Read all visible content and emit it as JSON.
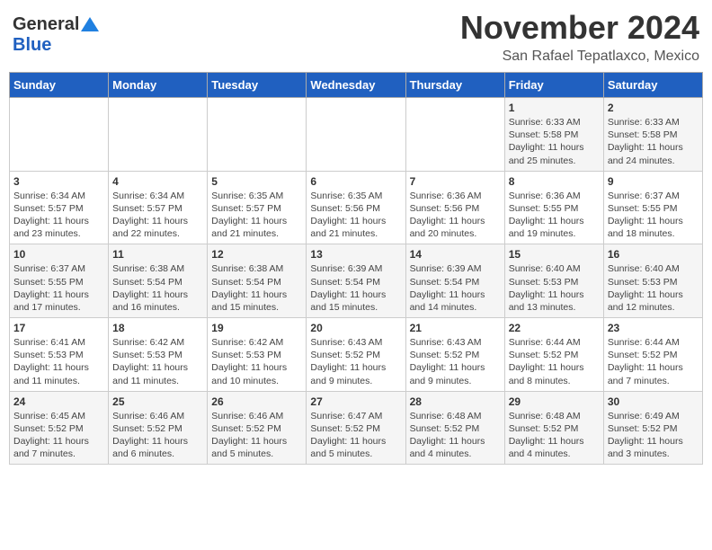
{
  "header": {
    "logo_general": "General",
    "logo_blue": "Blue",
    "month_title": "November 2024",
    "location": "San Rafael Tepatlaxco, Mexico"
  },
  "days_of_week": [
    "Sunday",
    "Monday",
    "Tuesday",
    "Wednesday",
    "Thursday",
    "Friday",
    "Saturday"
  ],
  "weeks": [
    [
      {
        "num": "",
        "detail": ""
      },
      {
        "num": "",
        "detail": ""
      },
      {
        "num": "",
        "detail": ""
      },
      {
        "num": "",
        "detail": ""
      },
      {
        "num": "",
        "detail": ""
      },
      {
        "num": "1",
        "detail": "Sunrise: 6:33 AM\nSunset: 5:58 PM\nDaylight: 11 hours\nand 25 minutes."
      },
      {
        "num": "2",
        "detail": "Sunrise: 6:33 AM\nSunset: 5:58 PM\nDaylight: 11 hours\nand 24 minutes."
      }
    ],
    [
      {
        "num": "3",
        "detail": "Sunrise: 6:34 AM\nSunset: 5:57 PM\nDaylight: 11 hours\nand 23 minutes."
      },
      {
        "num": "4",
        "detail": "Sunrise: 6:34 AM\nSunset: 5:57 PM\nDaylight: 11 hours\nand 22 minutes."
      },
      {
        "num": "5",
        "detail": "Sunrise: 6:35 AM\nSunset: 5:57 PM\nDaylight: 11 hours\nand 21 minutes."
      },
      {
        "num": "6",
        "detail": "Sunrise: 6:35 AM\nSunset: 5:56 PM\nDaylight: 11 hours\nand 21 minutes."
      },
      {
        "num": "7",
        "detail": "Sunrise: 6:36 AM\nSunset: 5:56 PM\nDaylight: 11 hours\nand 20 minutes."
      },
      {
        "num": "8",
        "detail": "Sunrise: 6:36 AM\nSunset: 5:55 PM\nDaylight: 11 hours\nand 19 minutes."
      },
      {
        "num": "9",
        "detail": "Sunrise: 6:37 AM\nSunset: 5:55 PM\nDaylight: 11 hours\nand 18 minutes."
      }
    ],
    [
      {
        "num": "10",
        "detail": "Sunrise: 6:37 AM\nSunset: 5:55 PM\nDaylight: 11 hours\nand 17 minutes."
      },
      {
        "num": "11",
        "detail": "Sunrise: 6:38 AM\nSunset: 5:54 PM\nDaylight: 11 hours\nand 16 minutes."
      },
      {
        "num": "12",
        "detail": "Sunrise: 6:38 AM\nSunset: 5:54 PM\nDaylight: 11 hours\nand 15 minutes."
      },
      {
        "num": "13",
        "detail": "Sunrise: 6:39 AM\nSunset: 5:54 PM\nDaylight: 11 hours\nand 15 minutes."
      },
      {
        "num": "14",
        "detail": "Sunrise: 6:39 AM\nSunset: 5:54 PM\nDaylight: 11 hours\nand 14 minutes."
      },
      {
        "num": "15",
        "detail": "Sunrise: 6:40 AM\nSunset: 5:53 PM\nDaylight: 11 hours\nand 13 minutes."
      },
      {
        "num": "16",
        "detail": "Sunrise: 6:40 AM\nSunset: 5:53 PM\nDaylight: 11 hours\nand 12 minutes."
      }
    ],
    [
      {
        "num": "17",
        "detail": "Sunrise: 6:41 AM\nSunset: 5:53 PM\nDaylight: 11 hours\nand 11 minutes."
      },
      {
        "num": "18",
        "detail": "Sunrise: 6:42 AM\nSunset: 5:53 PM\nDaylight: 11 hours\nand 11 minutes."
      },
      {
        "num": "19",
        "detail": "Sunrise: 6:42 AM\nSunset: 5:53 PM\nDaylight: 11 hours\nand 10 minutes."
      },
      {
        "num": "20",
        "detail": "Sunrise: 6:43 AM\nSunset: 5:52 PM\nDaylight: 11 hours\nand 9 minutes."
      },
      {
        "num": "21",
        "detail": "Sunrise: 6:43 AM\nSunset: 5:52 PM\nDaylight: 11 hours\nand 9 minutes."
      },
      {
        "num": "22",
        "detail": "Sunrise: 6:44 AM\nSunset: 5:52 PM\nDaylight: 11 hours\nand 8 minutes."
      },
      {
        "num": "23",
        "detail": "Sunrise: 6:44 AM\nSunset: 5:52 PM\nDaylight: 11 hours\nand 7 minutes."
      }
    ],
    [
      {
        "num": "24",
        "detail": "Sunrise: 6:45 AM\nSunset: 5:52 PM\nDaylight: 11 hours\nand 7 minutes."
      },
      {
        "num": "25",
        "detail": "Sunrise: 6:46 AM\nSunset: 5:52 PM\nDaylight: 11 hours\nand 6 minutes."
      },
      {
        "num": "26",
        "detail": "Sunrise: 6:46 AM\nSunset: 5:52 PM\nDaylight: 11 hours\nand 5 minutes."
      },
      {
        "num": "27",
        "detail": "Sunrise: 6:47 AM\nSunset: 5:52 PM\nDaylight: 11 hours\nand 5 minutes."
      },
      {
        "num": "28",
        "detail": "Sunrise: 6:48 AM\nSunset: 5:52 PM\nDaylight: 11 hours\nand 4 minutes."
      },
      {
        "num": "29",
        "detail": "Sunrise: 6:48 AM\nSunset: 5:52 PM\nDaylight: 11 hours\nand 4 minutes."
      },
      {
        "num": "30",
        "detail": "Sunrise: 6:49 AM\nSunset: 5:52 PM\nDaylight: 11 hours\nand 3 minutes."
      }
    ]
  ]
}
